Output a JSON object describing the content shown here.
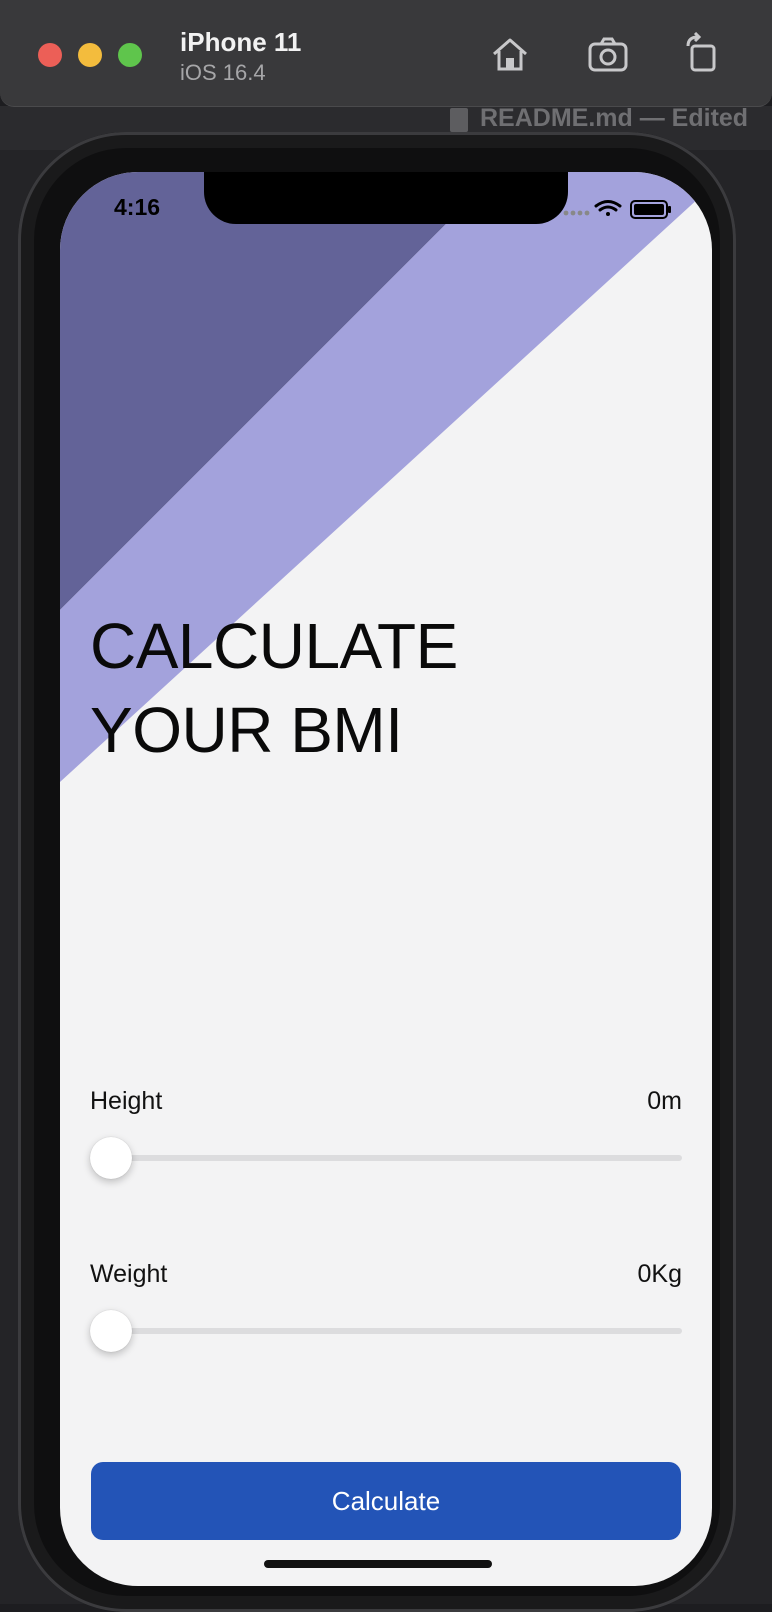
{
  "window": {
    "device_name": "iPhone 11",
    "os_version": "iOS 16.4",
    "tools": [
      "home-icon",
      "screenshot-icon",
      "rotate-icon"
    ]
  },
  "background": {
    "file_title": "README.md — Edited"
  },
  "status_bar": {
    "time": "4:16"
  },
  "theme": {
    "stripe_dark": "#636398",
    "stripe_light": "#a3a2dc",
    "screen_bg": "#f3f3f4",
    "accent": "#2354b7"
  },
  "headline": {
    "line1": "CALCULATE",
    "line2": "YOUR BMI"
  },
  "height": {
    "label": "Height",
    "value": "0m",
    "slider_fraction": 0
  },
  "weight": {
    "label": "Weight",
    "value": "0Kg",
    "slider_fraction": 0
  },
  "action": {
    "button_label": "Calculate"
  }
}
